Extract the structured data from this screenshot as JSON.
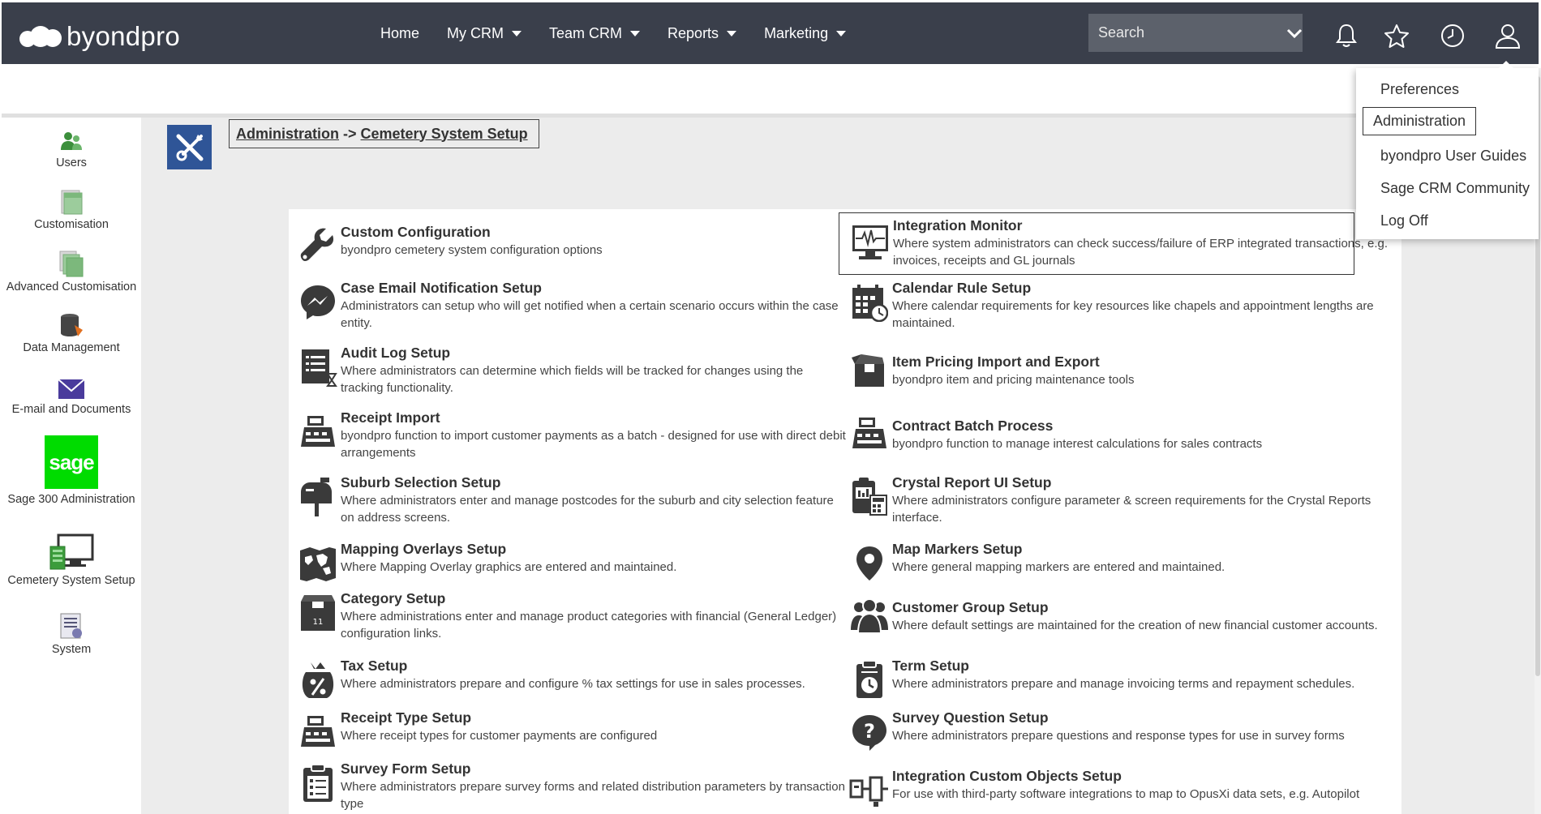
{
  "brand": {
    "name": "byondpro"
  },
  "nav": {
    "items": [
      {
        "label": "Home",
        "has_menu": false
      },
      {
        "label": "My CRM",
        "has_menu": true
      },
      {
        "label": "Team CRM",
        "has_menu": true
      },
      {
        "label": "Reports",
        "has_menu": true
      },
      {
        "label": "Marketing",
        "has_menu": true
      }
    ]
  },
  "search": {
    "placeholder": "Search"
  },
  "top_icons": [
    "bell-icon",
    "star-icon",
    "clock-icon",
    "user-icon"
  ],
  "user_menu": {
    "items": [
      {
        "label": "Preferences",
        "active": false
      },
      {
        "label": "Administration",
        "active": true
      },
      {
        "label": "byondpro User Guides",
        "active": false
      },
      {
        "label": "Sage CRM Community",
        "active": false
      },
      {
        "label": "Log Off",
        "active": false
      }
    ]
  },
  "sidebar": {
    "items": [
      {
        "label": "Users"
      },
      {
        "label": "Customisation"
      },
      {
        "label": "Advanced Customisation"
      },
      {
        "label": "Data Management"
      },
      {
        "label": "E-mail and Documents"
      },
      {
        "label": "Sage 300 Administration",
        "logo_text": "sage"
      },
      {
        "label": "Cemetery System Setup"
      },
      {
        "label": "System"
      }
    ]
  },
  "breadcrumb": {
    "parent": "Administration",
    "separator": "->",
    "current": "Cemetery System Setup"
  },
  "entries": {
    "left": [
      {
        "title": "Custom Configuration",
        "desc": "byondpro cemetery system configuration options",
        "icon": "wrench-icon"
      },
      {
        "title": "Case Email Notification Setup",
        "desc": "Administrators can setup who will get notified when a certain scenario occurs within the case entity.",
        "icon": "messenger-icon"
      },
      {
        "title": "Audit Log Setup",
        "desc": "Where administrators can determine which fields will be tracked for changes using the tracking functionality.",
        "icon": "audit-list-icon"
      },
      {
        "title": "Receipt Import",
        "desc": "byondpro function to import customer payments as a batch - designed for use with direct debit arrangements",
        "icon": "cash-register-icon"
      },
      {
        "title": "Suburb Selection Setup",
        "desc": "Where administrators enter and manage postcodes for the suburb and city selection feature on address screens.",
        "icon": "mailbox-icon"
      },
      {
        "title": "Mapping Overlays Setup",
        "desc": "Where Mapping Overlay graphics are entered and maintained.",
        "icon": "world-map-icon"
      },
      {
        "title": "Category Setup",
        "desc": "Where administrations enter and manage product categories with financial (General Ledger) configuration links.",
        "icon": "box-icon"
      },
      {
        "title": "Tax Setup",
        "desc": "Where administrators prepare and configure % tax settings for use in sales processes.",
        "icon": "tax-bag-icon"
      },
      {
        "title": "Receipt Type Setup",
        "desc": "Where receipt types for customer payments are configured",
        "icon": "cash-register-icon"
      },
      {
        "title": "Survey Form Setup",
        "desc": "Where administrators prepare survey forms and related distribution parameters by transaction type",
        "icon": "clipboard-icon"
      }
    ],
    "right": [
      {
        "title": "Integration Monitor",
        "desc": "Where system administrators can check success/failure of ERP integrated transactions, e.g. invoices, receipts and GL journals",
        "icon": "monitor-pulse-icon",
        "highlighted": true
      },
      {
        "title": "Calendar Rule Setup",
        "desc": "Where calendar requirements for key resources like chapels and appointment lengths are maintained.",
        "icon": "calendar-clock-icon"
      },
      {
        "title": "Item Pricing Import and Export",
        "desc": "byondpro item and pricing maintenance tools",
        "icon": "open-box-icon"
      },
      {
        "title": "Contract Batch Process",
        "desc": "byondpro function to manage interest calculations for sales contracts",
        "icon": "cash-register-icon"
      },
      {
        "title": "Crystal Report UI Setup",
        "desc": "Where administrators configure parameter & screen requirements for the Crystal Reports interface.",
        "icon": "report-calculator-icon"
      },
      {
        "title": "Map Markers Setup",
        "desc": "Where general mapping markers are entered and maintained.",
        "icon": "map-pin-icon"
      },
      {
        "title": "Customer Group Setup",
        "desc": "Where default settings are maintained for the creation of new financial customer accounts.",
        "icon": "people-group-icon"
      },
      {
        "title": "Term Setup",
        "desc": "Where administrators prepare and manage invoicing terms and repayment schedules.",
        "icon": "term-clock-icon"
      },
      {
        "title": "Survey Question Setup",
        "desc": "Where administrators prepare questions and response types for use in survey forms",
        "icon": "question-bubble-icon"
      },
      {
        "title": "Integration Custom Objects Setup",
        "desc": "For use with third-party software integrations to map to OpusXi data sets, e.g. Autopilot",
        "icon": "integration-objects-icon"
      }
    ]
  },
  "colors": {
    "topbar": "#3a3f4b",
    "search_bg": "#5c616b",
    "accent_blue": "#2f5597",
    "sage_green": "#00dc00",
    "page_gray": "#ececec",
    "icon_dark": "#3a3a3a"
  }
}
